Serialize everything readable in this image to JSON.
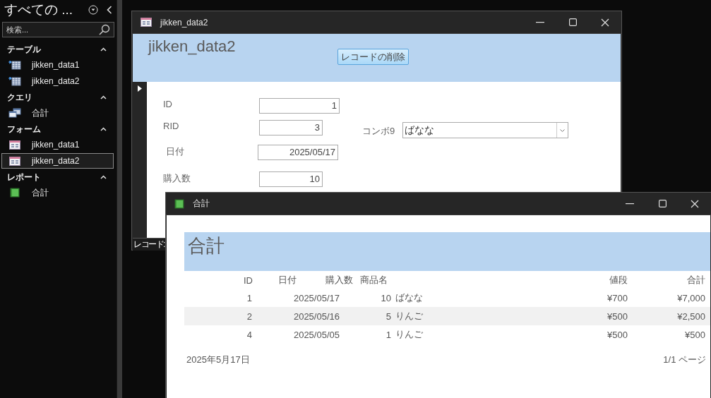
{
  "nav_pane": {
    "title": "すべての ...",
    "search": {
      "placeholder": "検索..."
    },
    "groups": [
      {
        "label": "テーブル",
        "expanded": true,
        "items": [
          {
            "label": "jikken_data1",
            "kind": "table",
            "selected": false
          },
          {
            "label": "jikken_data2",
            "kind": "table",
            "selected": false
          }
        ]
      },
      {
        "label": "クエリ",
        "expanded": true,
        "items": [
          {
            "label": "合計",
            "kind": "query",
            "selected": false
          }
        ]
      },
      {
        "label": "フォーム",
        "expanded": true,
        "items": [
          {
            "label": "jikken_data1",
            "kind": "form",
            "selected": false
          },
          {
            "label": "jikken_data2",
            "kind": "form",
            "selected": true
          }
        ]
      },
      {
        "label": "レポート",
        "expanded": true,
        "items": [
          {
            "label": "合計",
            "kind": "report",
            "selected": false
          }
        ]
      }
    ]
  },
  "form_window": {
    "title": "jikken_data2",
    "header_title": "jikken_data2",
    "delete_button": "レコードの削除",
    "fields": [
      {
        "label": "ID",
        "value": "1"
      },
      {
        "label": "RID",
        "value": "3"
      },
      {
        "label": "日付",
        "value": "2025/05/17"
      },
      {
        "label": "購入数",
        "value": "10"
      }
    ],
    "combo": {
      "label": "コンボ9",
      "value": "ばなな"
    },
    "record_nav": "レコード:"
  },
  "report_window": {
    "title": "合計",
    "heading": "合計",
    "columns": [
      "ID",
      "日付",
      "購入数",
      "商品名",
      "値段",
      "合計"
    ],
    "rows": [
      [
        "1",
        "2025/05/17",
        "10",
        "ばなな",
        "¥700",
        "¥7,000"
      ],
      [
        "2",
        "2025/05/16",
        "5",
        "りんご",
        "¥500",
        "¥2,500"
      ],
      [
        "4",
        "2025/05/05",
        "1",
        "りんご",
        "¥500",
        "¥500"
      ]
    ],
    "footer_date": "2025年5月17日",
    "page": "1/1 ページ"
  }
}
